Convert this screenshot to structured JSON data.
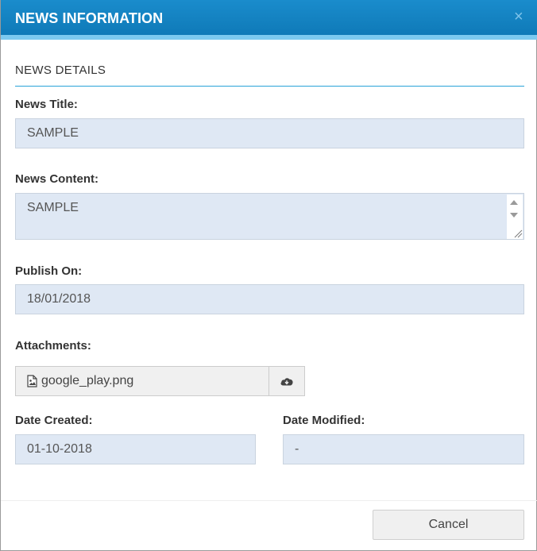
{
  "modal": {
    "title": "NEWS INFORMATION",
    "close_glyph": "×"
  },
  "section": {
    "title": "NEWS DETAILS"
  },
  "fields": {
    "news_title": {
      "label": "News Title:",
      "value": "SAMPLE"
    },
    "news_content": {
      "label": "News Content:",
      "value": "SAMPLE"
    },
    "publish_on": {
      "label": "Publish On:",
      "value": "18/01/2018"
    },
    "attachments": {
      "label": "Attachments:",
      "file_name": "google_play.png"
    },
    "date_created": {
      "label": "Date Created:",
      "value": "01-10-2018"
    },
    "date_modified": {
      "label": "Date Modified:",
      "value": "-"
    }
  },
  "footer": {
    "cancel_label": "Cancel"
  },
  "icons": {
    "close": "close-icon",
    "file": "image-file-icon",
    "download": "cloud-download-icon"
  },
  "colors": {
    "header": "#1a8ccc",
    "header_strip": "#7ccaf0",
    "field_bg": "#dfe8f4",
    "section_rule": "#29a3d8"
  }
}
